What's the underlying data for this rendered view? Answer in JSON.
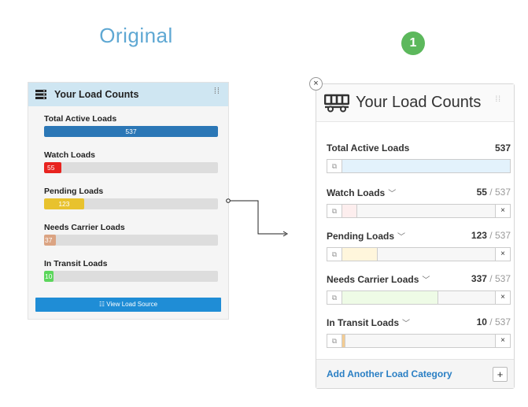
{
  "original_title": "Original",
  "step_badge": "1",
  "original_widget": {
    "title": "Your Load Counts",
    "items": [
      {
        "label": "Total Active Loads",
        "value": "537",
        "fill_pct": 100,
        "color": "#2b77b6",
        "value_align": "center"
      },
      {
        "label": "Watch Loads",
        "value": "55",
        "fill_pct": 10,
        "color": "#e8231f",
        "value_align": "left"
      },
      {
        "label": "Pending Loads",
        "value": "123",
        "fill_pct": 23,
        "color": "#e8c22e",
        "value_align": "center"
      },
      {
        "label": "Needs Carrier Loads",
        "value": "37",
        "fill_pct": 7,
        "color": "#dba483",
        "value_align": "left"
      },
      {
        "label": "In Transit Loads",
        "value": "10",
        "fill_pct": 2,
        "color": "#5cd65c",
        "value_align": "left"
      }
    ],
    "button_label": "☷ View Load Source"
  },
  "new_widget": {
    "title": "Your Load Counts",
    "items": [
      {
        "label": "Total Active Loads",
        "count": "537",
        "total": "",
        "fill_pct": 100,
        "color": "#e3f2fc",
        "dropdown": false,
        "removable": false
      },
      {
        "label": "Watch Loads",
        "count": "55",
        "total": "537",
        "fill_pct": 10,
        "color": "#fdeeee",
        "dropdown": true,
        "removable": true
      },
      {
        "label": "Pending Loads",
        "count": "123",
        "total": "537",
        "fill_pct": 23,
        "color": "#fff6dc",
        "dropdown": true,
        "removable": true
      },
      {
        "label": "Needs Carrier Loads",
        "count": "337",
        "total": "537",
        "fill_pct": 63,
        "color": "#eefbe6",
        "dropdown": true,
        "removable": true
      },
      {
        "label": "In Transit Loads",
        "count": "10",
        "total": "537",
        "fill_pct": 2,
        "color": "#f4cc92",
        "dropdown": true,
        "removable": true
      }
    ],
    "add_label": "Add Another Load Category",
    "add_icon": "+",
    "close_icon": "×"
  }
}
